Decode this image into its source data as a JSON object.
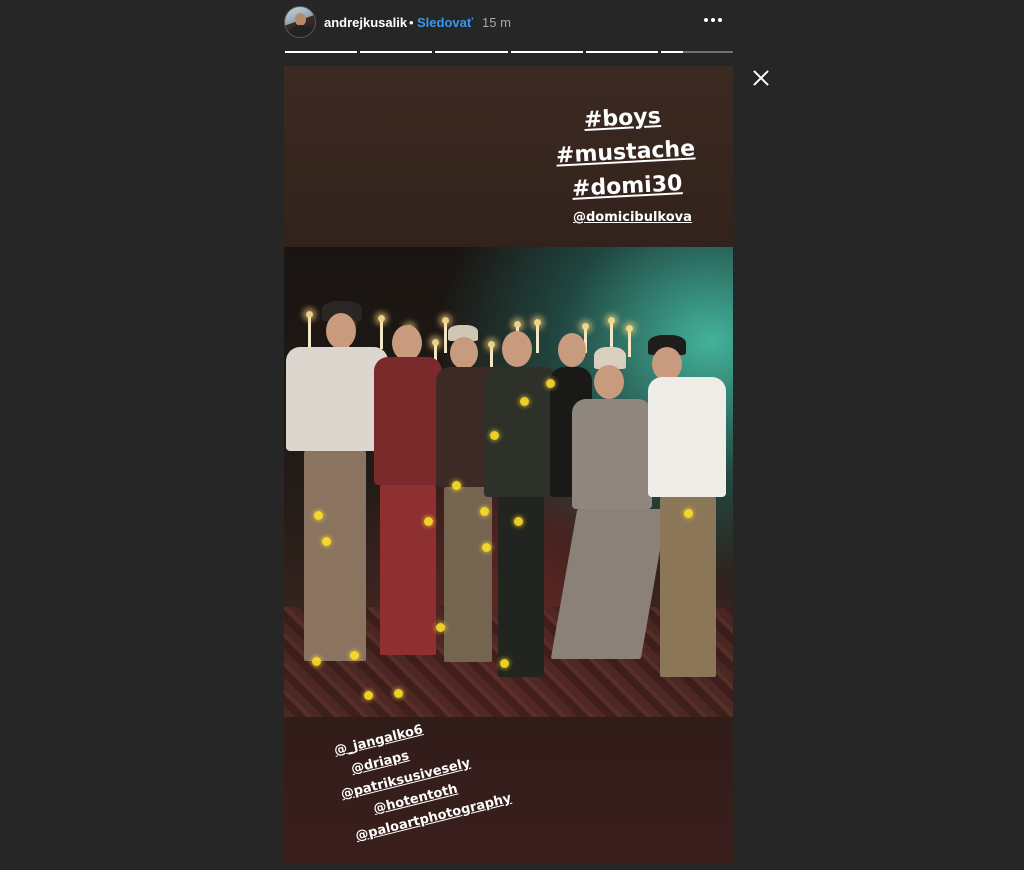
{
  "header": {
    "username": "andrejkusalik",
    "separator": "•",
    "follow_label": "Sledovať",
    "time": "15 m"
  },
  "progress": {
    "segments": 6,
    "current_index": 5,
    "current_fraction": 0.3
  },
  "story": {
    "hashtags": [
      "#boys",
      "#mustache",
      "#domi30"
    ],
    "top_mention": "@domicibulkova",
    "mentions": [
      "@_jangalko6",
      "@driaps",
      "@patriksusivesely",
      "@hotentoth",
      "@paloartphotography"
    ]
  },
  "icons": {
    "more": "more-horizontal-icon",
    "close": "close-icon",
    "avatar": "profile-avatar"
  },
  "colors": {
    "follow": "#3897f0",
    "background": "#262626"
  }
}
